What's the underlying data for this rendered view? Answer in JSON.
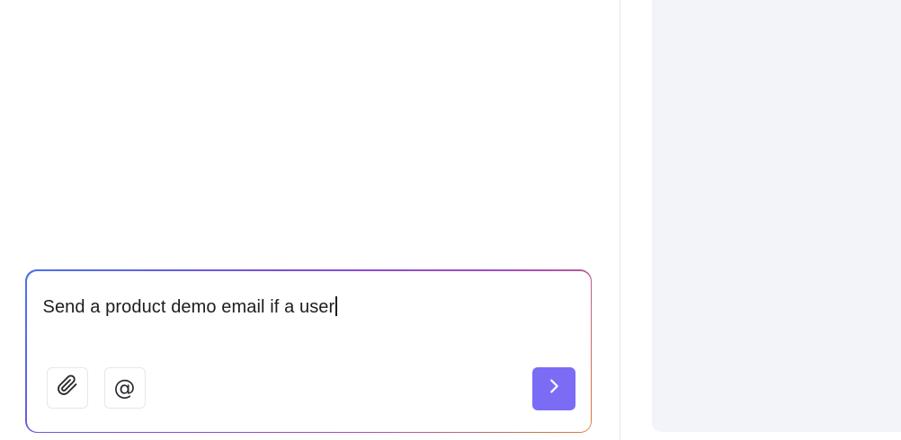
{
  "composer": {
    "text": "Send a product demo email if a user"
  },
  "toolbar": {
    "attach_icon": "paperclip-icon",
    "mention_icon": "at-sign-icon",
    "mention_glyph": "@",
    "send_icon": "chevron-right-icon"
  },
  "colors": {
    "accent": "#7b6cf6",
    "right_panel_bg": "#f2f4f9",
    "border_gradient": [
      "#4a73e8",
      "#7b4fd9",
      "#a04cc8",
      "#e07b2e"
    ]
  }
}
